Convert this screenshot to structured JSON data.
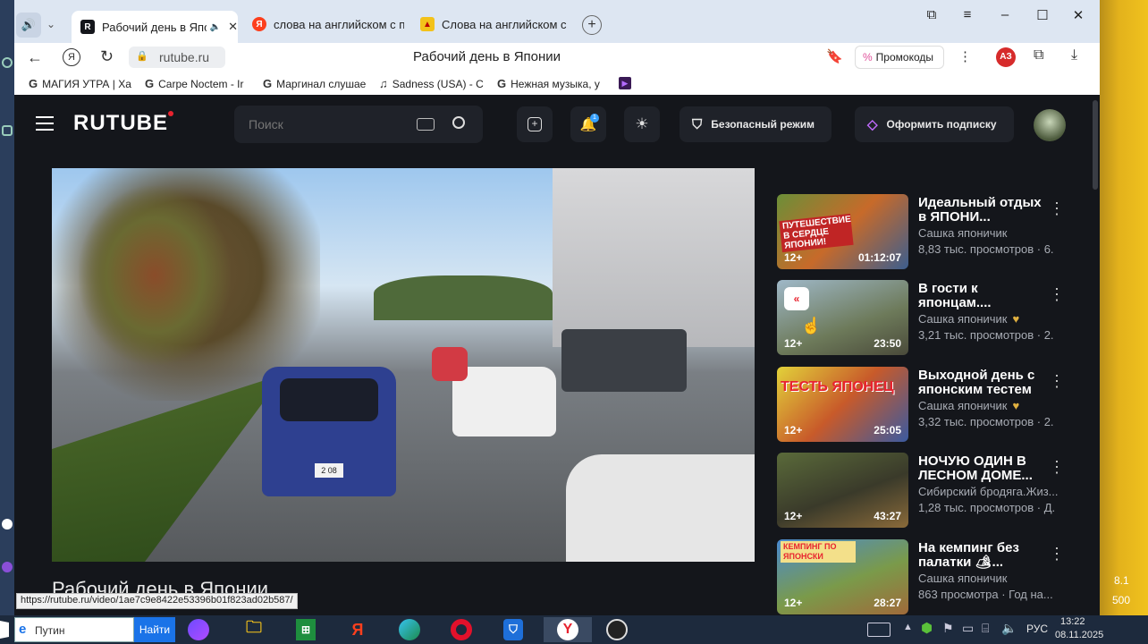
{
  "tabs": [
    {
      "label": "Рабочий день в Японии",
      "active": true
    },
    {
      "label": "слова на английском с пе",
      "active": false
    },
    {
      "label": "Слова на английском с пе",
      "active": false
    }
  ],
  "address": {
    "domain": "rutube.ru",
    "page_title": "Рабочий день в Японии",
    "promo_label": "Промокоды",
    "profile_badge": "АЗ"
  },
  "bookmarks": [
    "МАГИЯ УТРА | Ха",
    "Carpe Noctem - Ir",
    "Маргинал слушае",
    "Sadness (USA) - C",
    "Нежная музыка, у"
  ],
  "rutube": {
    "logo": "RUTUBE",
    "search_placeholder": "Поиск",
    "safe_mode": "Безопасный режим",
    "subscribe": "Оформить подписку",
    "notification_count": "1",
    "video_title": "Рабочий день в Японии",
    "status_url": "https://rutube.ru/video/1ae7c9e8422e53396b01f823ad02b587/"
  },
  "recommendations": [
    {
      "title": "Идеальный отдых в ЯПОНИ...",
      "channel": "Сашка японичик",
      "views": "8,83 тыс. просмотров · 6.",
      "age": "12+",
      "duration": "01:12:07",
      "thumb_text": "ПУТЕШЕСТВИЕ В СЕРДЦЕ ЯПОНИИ!"
    },
    {
      "title": "В гости к японцам....",
      "channel": "Сашка японичик",
      "views": "3,21 тыс. просмотров · 2.",
      "age": "12+",
      "duration": "23:50",
      "thumb_text": ""
    },
    {
      "title": "Выходной день с японским тестем",
      "channel": "Сашка японичик",
      "views": "3,32 тыс. просмотров · 2.",
      "age": "12+",
      "duration": "25:05",
      "thumb_text": "ТЕСТЬ ЯПОНЕЦ"
    },
    {
      "title": "НОЧУЮ ОДИН В ЛЕСНОМ ДОМЕ...",
      "channel": "Сибирский бродяга.Жиз...",
      "views": "1,28 тыс. просмотров · Д.",
      "age": "12+",
      "duration": "43:27",
      "thumb_text": ""
    },
    {
      "title": "На кемпинг без палатки 🏕...",
      "channel": "Сашка японичик",
      "views": "863 просмотра · Год на...",
      "age": "12+",
      "duration": "28:27",
      "thumb_text": "КЕМПИНГ ПО ЯПОНСКИ"
    }
  ],
  "taskbar": {
    "search_value": "Путин",
    "search_button": "Найти",
    "lang": "РУС",
    "time": "13:22",
    "date": "08.11.2025"
  },
  "side_right": {
    "line1": "8.1",
    "line2": "500"
  },
  "colors": {
    "rutube_bg": "#14161b",
    "accent": "#e8232f",
    "tab_bar": "#dde6f2"
  }
}
